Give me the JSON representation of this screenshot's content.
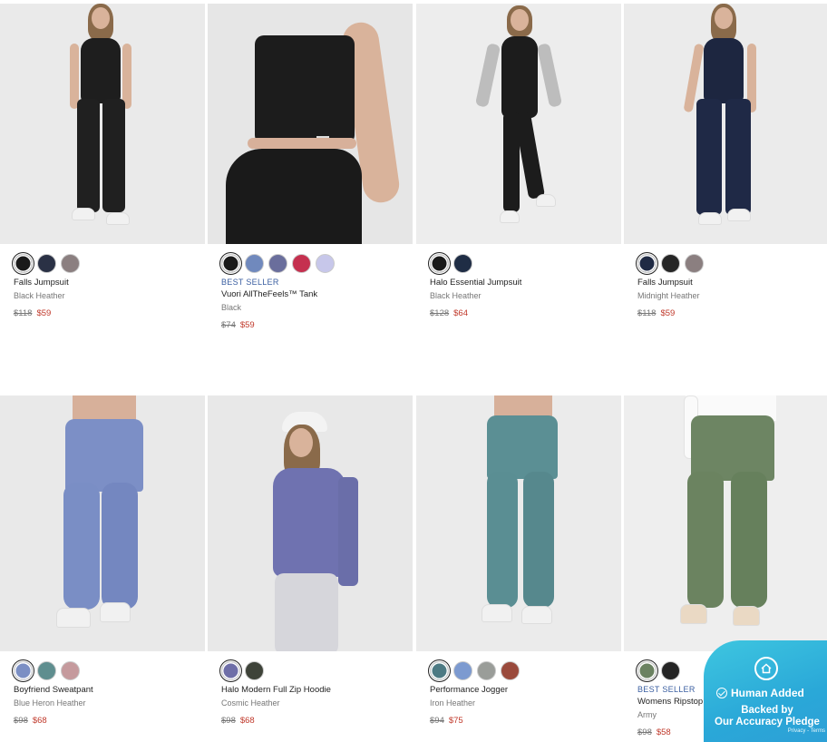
{
  "products": [
    {
      "name": "Falls Jumpsuit",
      "color": "Black Heather",
      "price_old": "$118",
      "price_new": "$59",
      "badge": "",
      "swatches": [
        "#1a1a1a",
        "#2a3145",
        "#8b7f80"
      ],
      "selected": 0
    },
    {
      "name": "Vuori AllTheFeels™ Tank",
      "color": "Black",
      "price_old": "$74",
      "price_new": "$59",
      "badge": "BEST SELLER",
      "swatches": [
        "#1a1a1a",
        "#7089bd",
        "#6a6e9c",
        "#c5304f",
        "#c7c7ea"
      ],
      "selected": 0
    },
    {
      "name": "Halo Essential Jumpsuit",
      "color": "Black Heather",
      "price_old": "$128",
      "price_new": "$64",
      "badge": "",
      "swatches": [
        "#1a1a1a",
        "#1f2d45"
      ],
      "selected": 0
    },
    {
      "name": "Falls Jumpsuit",
      "color": "Midnight Heather",
      "price_old": "$118",
      "price_new": "$59",
      "badge": "",
      "swatches": [
        "#1f2a44",
        "#262626",
        "#8b7f80"
      ],
      "selected": 0
    },
    {
      "name": "Boyfriend Sweatpant",
      "color": "Blue Heron Heather",
      "price_old": "$98",
      "price_new": "$68",
      "badge": "",
      "swatches": [
        "#7b8fc4",
        "#5f8e8f",
        "#c59a9d"
      ],
      "selected": 0
    },
    {
      "name": "Halo Modern Full Zip Hoodie",
      "color": "Cosmic Heather",
      "price_old": "$98",
      "price_new": "$68",
      "badge": "",
      "swatches": [
        "#6e6ea8",
        "#3e4339"
      ],
      "selected": 0
    },
    {
      "name": "Performance Jogger",
      "color": "Iron Heather",
      "price_old": "$94",
      "price_new": "$75",
      "badge": "",
      "swatches": [
        "#4d7a83",
        "#7c9ad0",
        "#9a9d99",
        "#9a4a3c"
      ],
      "selected": 0
    },
    {
      "name": "Womens Ripstop Pant",
      "color": "Army",
      "price_old": "$98",
      "price_new": "$58",
      "badge": "BEST SELLER",
      "swatches": [
        "#6b8261",
        "#252525"
      ],
      "selected": 0
    }
  ],
  "pledge": {
    "title": "Human Added",
    "line1": "Backed by",
    "line2": "Our Accuracy Pledge",
    "footer": "Privacy - Terms"
  },
  "icons": {
    "pledge": "house-icon",
    "check": "check-circle-icon"
  }
}
